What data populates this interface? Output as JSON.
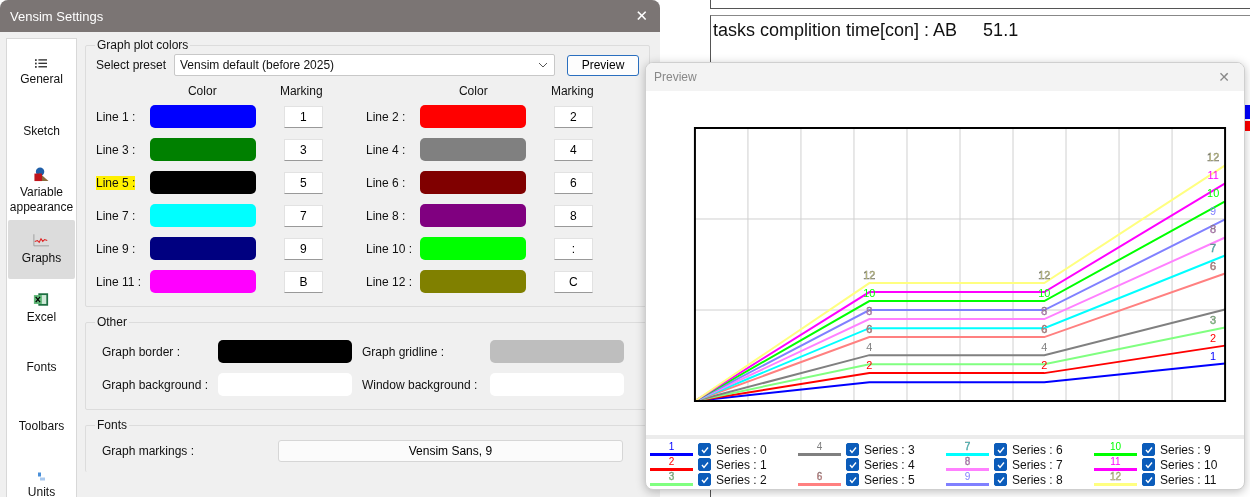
{
  "settings": {
    "title": "Vensim Settings",
    "close": "✕",
    "sidebar": [
      {
        "label": "General",
        "kind": "list",
        "selected": false
      },
      {
        "label": "Sketch",
        "selected": false
      },
      {
        "label": "Variable appearance",
        "kind": "shapes",
        "selected": false
      },
      {
        "label": "Graphs",
        "kind": "graph",
        "selected": true
      },
      {
        "label": "Excel",
        "kind": "excel",
        "selected": false
      },
      {
        "label": "Fonts",
        "selected": false
      },
      {
        "label": "Toolbars",
        "selected": false
      },
      {
        "label": "Units",
        "kind": "units",
        "selected": false
      }
    ],
    "plot_colors": {
      "title": "Graph plot colors",
      "preset_label": "Select preset",
      "preset": "Vensim default (before 2025)",
      "preview_button": "Preview",
      "headers": [
        "Color",
        "Marking",
        "Color",
        "Marking"
      ],
      "lines": [
        {
          "label": "Line 1 :",
          "color": "#0000ff",
          "marking": "1",
          "highlighted": false
        },
        {
          "label": "Line 2 :",
          "color": "#ff0000",
          "marking": "2",
          "highlighted": false
        },
        {
          "label": "Line 3 :",
          "color": "#008000",
          "marking": "3",
          "highlighted": false
        },
        {
          "label": "Line 4 :",
          "color": "#808080",
          "marking": "4",
          "highlighted": false
        },
        {
          "label": "Line 5 :",
          "color": "#000000",
          "marking": "5",
          "highlighted": true
        },
        {
          "label": "Line 6 :",
          "color": "#800000",
          "marking": "6",
          "highlighted": false
        },
        {
          "label": "Line 7 :",
          "color": "#00ffff",
          "marking": "7",
          "highlighted": false
        },
        {
          "label": "Line 8 :",
          "color": "#800080",
          "marking": "8",
          "highlighted": false
        },
        {
          "label": "Line 9 :",
          "color": "#000080",
          "marking": "9",
          "highlighted": false
        },
        {
          "label": "Line 10 :",
          "color": "#00ff00",
          "marking": ":",
          "highlighted": false
        },
        {
          "label": "Line 11 :",
          "color": "#ff00ff",
          "marking": "B",
          "highlighted": false
        },
        {
          "label": "Line 12 :",
          "color": "#808000",
          "marking": "C",
          "highlighted": false
        }
      ]
    },
    "other": {
      "title": "Other",
      "items": [
        {
          "label": "Graph border :",
          "color": "#000000"
        },
        {
          "label": "Graph gridline :",
          "color": "#bebebe"
        },
        {
          "label": "Graph background :",
          "color": "#ffffff"
        },
        {
          "label": "Window background :",
          "color": "#ffffff"
        }
      ]
    },
    "fonts": {
      "title": "Fonts",
      "items": [
        {
          "label": "Graph markings :",
          "value": "Vensim Sans, 9"
        }
      ]
    }
  },
  "background": {
    "rows": [
      {
        "name": "tasks complition time[con] : AB",
        "value": "51.1"
      }
    ]
  },
  "preview": {
    "title": "Preview",
    "close": "✕",
    "series": [
      {
        "label": "Series : 0",
        "marking": "1",
        "color": "#0000ff",
        "checked": true,
        "chart_labels": [
          "1"
        ]
      },
      {
        "label": "Series : 1",
        "marking": "2",
        "color": "#ff0000",
        "checked": true,
        "chart_labels": [
          "2",
          "2",
          "2"
        ]
      },
      {
        "label": "Series : 2",
        "marking": "3",
        "color": "#80ff80",
        "checked": true,
        "chart_labels": [
          "3"
        ]
      },
      {
        "label": "Series : 3",
        "marking": "4",
        "color": "#808080",
        "checked": true,
        "chart_labels": [
          "4",
          "4"
        ]
      },
      {
        "label": "Series : 4",
        "checked": true
      },
      {
        "label": "Series : 5",
        "marking": "6",
        "color": "#ff8080",
        "checked": true,
        "chart_labels": [
          "6",
          "6",
          "6"
        ]
      },
      {
        "label": "Series : 6",
        "marking": "7",
        "color": "#00ffff",
        "checked": true,
        "chart_labels": [
          "7"
        ]
      },
      {
        "label": "Series : 7",
        "marking": "8",
        "color": "#ff80ff",
        "checked": true,
        "chart_labels": [
          "8",
          "8",
          "8"
        ]
      },
      {
        "label": "Series : 8",
        "marking": "9",
        "color": "#8080ff",
        "checked": true,
        "chart_labels": [
          "9"
        ]
      },
      {
        "label": "Series : 9",
        "marking": "10",
        "color": "#00ff00",
        "checked": true,
        "chart_labels": [
          "10",
          "10",
          "10"
        ]
      },
      {
        "label": "Series : 10",
        "marking": "11",
        "color": "#ff00ff",
        "checked": true,
        "chart_labels": [
          "11"
        ]
      },
      {
        "label": "Series : 11",
        "marking": "12",
        "color": "#ffff80",
        "checked": true,
        "chart_labels": [
          "12",
          "12",
          "12"
        ]
      }
    ]
  }
}
